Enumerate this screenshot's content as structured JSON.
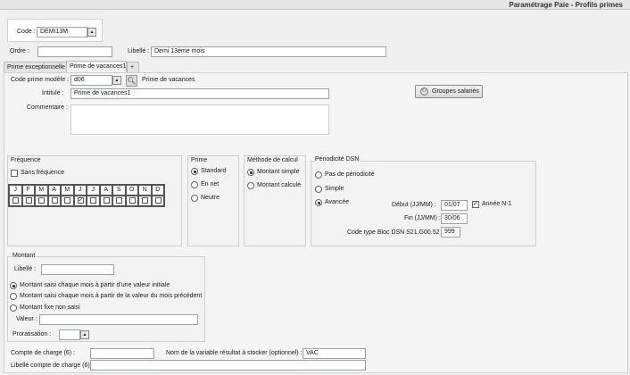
{
  "window": {
    "title": "Paramétrage Paie - Profils primes"
  },
  "header": {
    "code_label": "Code :",
    "code_value": "DEMI13M",
    "ordre_label": "Ordre :",
    "ordre_value": "",
    "libelle_label": "Libellé :",
    "libelle_value": "Demi 13ème mois"
  },
  "tabs": [
    {
      "label": "Prime exceptionnelle",
      "active": false
    },
    {
      "label": "Prime de vacances1",
      "active": true
    },
    {
      "label": "+",
      "active": false
    }
  ],
  "form": {
    "code_prime_label": "Code prime modèle :",
    "code_prime_value": "d06",
    "code_prime_desc": "Prime de vacances",
    "intitule_label": "Intitulé :",
    "intitule_value": "Prime de vacances1",
    "commentaire_label": "Commentaire :",
    "groupes_button": "Groupes salariés"
  },
  "frequence": {
    "title": "Fréquence",
    "sans_frequence_label": "Sans fréquence",
    "sans_frequence_checked": false,
    "months": [
      "J",
      "F",
      "M",
      "A",
      "M",
      "J",
      "J",
      "A",
      "S",
      "O",
      "N",
      "D"
    ],
    "months_checked": [
      false,
      false,
      false,
      false,
      false,
      true,
      false,
      false,
      false,
      false,
      false,
      false
    ]
  },
  "prime": {
    "title": "Prime",
    "options": [
      "Standard",
      "En net",
      "Neutre"
    ],
    "selected": 0
  },
  "methode": {
    "title": "Méthode de calcul",
    "options": [
      "Montant simple",
      "Montant calculé"
    ],
    "selected": 0
  },
  "periodicite": {
    "title": "Périodicité DSN",
    "options": [
      "Pas de périodicité",
      "Simple",
      "Avancée"
    ],
    "selected": 2,
    "debut_label": "Début (JJ/MM) :",
    "debut_value": "01/07",
    "annee_label": "Année N-1",
    "annee_checked": true,
    "fin_label": "Fin (JJ/MM) :",
    "fin_value": "30/06",
    "code_bloc_label": "Code type Bloc DSN S21.G00.52 :",
    "code_bloc_value": "999"
  },
  "montant": {
    "title": "Montant",
    "libelle_label": "Libellé :",
    "libelle_value": "",
    "options": [
      "Montant saisi chaque mois à partir d'une valeur initiale",
      "Montant saisi chaque mois à partir de la valeur du mois précédent",
      "Montant fixe non saisi"
    ],
    "selected": 0,
    "valeur_label": "Valeur :",
    "valeur_value": "",
    "proratisation_label": "Proratisation :",
    "proratisation_value": ""
  },
  "footer": {
    "compte_label": "Compte de charge (6) :",
    "compte_value": "",
    "nom_variable_label": "Nom de la variable résultat à stocker (optionnel) :",
    "nom_variable_value": "VAC",
    "libelle_compte_label": "Libellé compte de charge (6) :",
    "libelle_compte_value": ""
  }
}
